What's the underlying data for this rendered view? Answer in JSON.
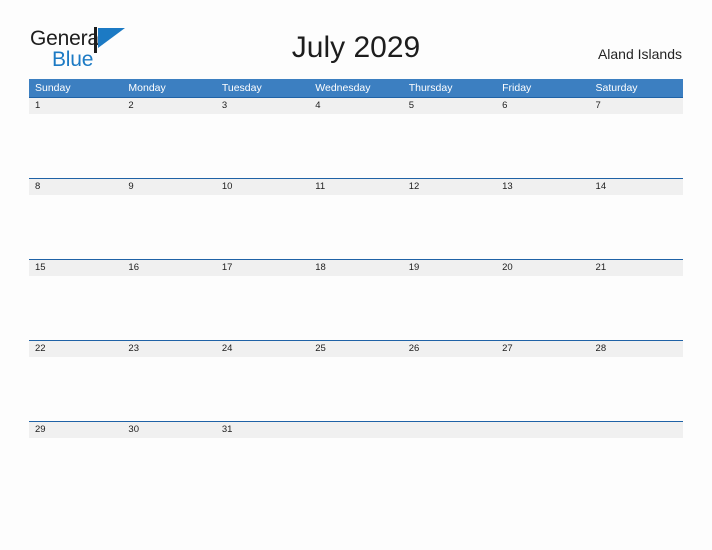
{
  "branding": {
    "name_part1": "General",
    "name_part2": "Blue",
    "flag_icon": "blue-flag-icon",
    "color_dark": "#1d1d1d",
    "color_blue": "#1c7ac4"
  },
  "header": {
    "title": "July 2029",
    "location": "Aland Islands"
  },
  "calendar": {
    "accent_header_bg": "#3c7fc1",
    "row_band_bg": "#f0f0f0",
    "row_divider_color": "#1f62a6",
    "weekdays": [
      "Sunday",
      "Monday",
      "Tuesday",
      "Wednesday",
      "Thursday",
      "Friday",
      "Saturday"
    ],
    "weeks": [
      [
        "1",
        "2",
        "3",
        "4",
        "5",
        "6",
        "7"
      ],
      [
        "8",
        "9",
        "10",
        "11",
        "12",
        "13",
        "14"
      ],
      [
        "15",
        "16",
        "17",
        "18",
        "19",
        "20",
        "21"
      ],
      [
        "22",
        "23",
        "24",
        "25",
        "26",
        "27",
        "28"
      ],
      [
        "29",
        "30",
        "31",
        "",
        "",
        "",
        ""
      ]
    ]
  }
}
